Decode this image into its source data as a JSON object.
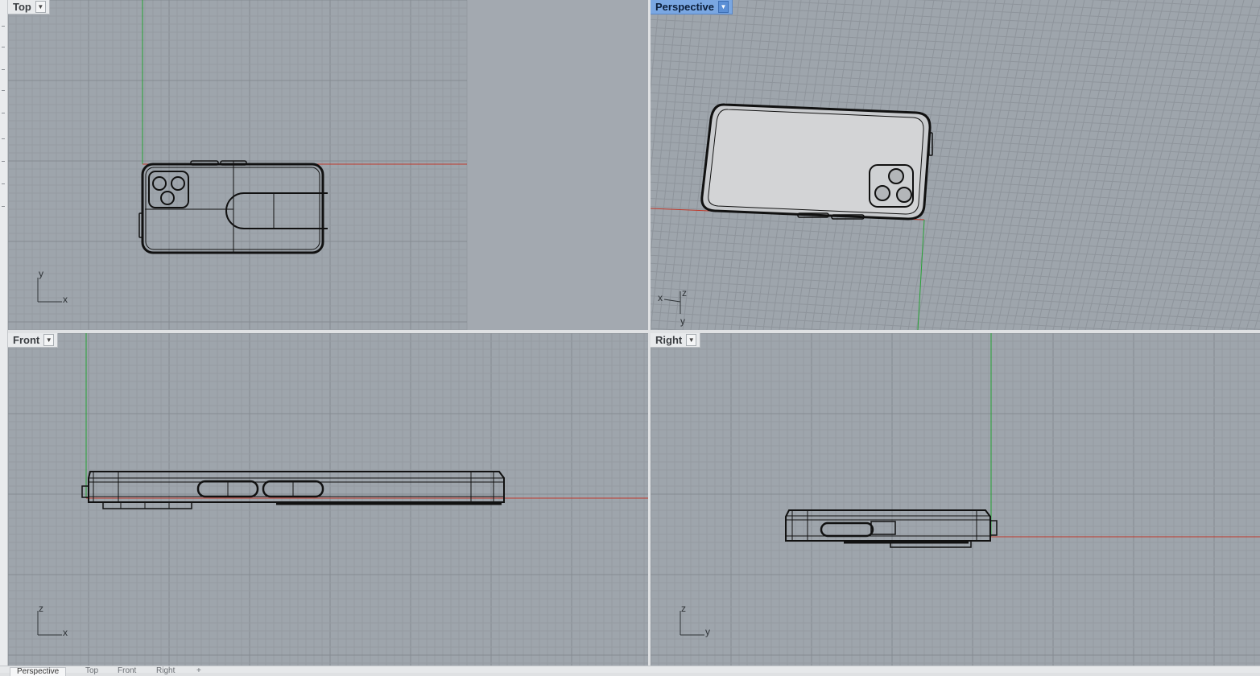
{
  "viewports": {
    "top": {
      "label": "Top",
      "axis_v": "y",
      "axis_h": "x"
    },
    "perspective": {
      "label": "Perspective",
      "axis_v": "z",
      "axis_h": "x",
      "axis_d": "y"
    },
    "front": {
      "label": "Front",
      "axis_v": "z",
      "axis_h": "x"
    },
    "right": {
      "label": "Right",
      "axis_v": "z",
      "axis_h": "y"
    }
  },
  "bottom_tabs": [
    {
      "label": "Perspective",
      "active": true
    },
    {
      "label": "Top"
    },
    {
      "label": "Front"
    },
    {
      "label": "Right"
    }
  ],
  "icons": {
    "menu": "chevron-down-icon",
    "add_tab": "plus-icon"
  },
  "colors": {
    "grid_bg": "#9ea5ac",
    "x_axis": "#c0392b",
    "y_axis": "#27a236",
    "model_line": "#111111",
    "active_label": "#7aa7e2"
  }
}
